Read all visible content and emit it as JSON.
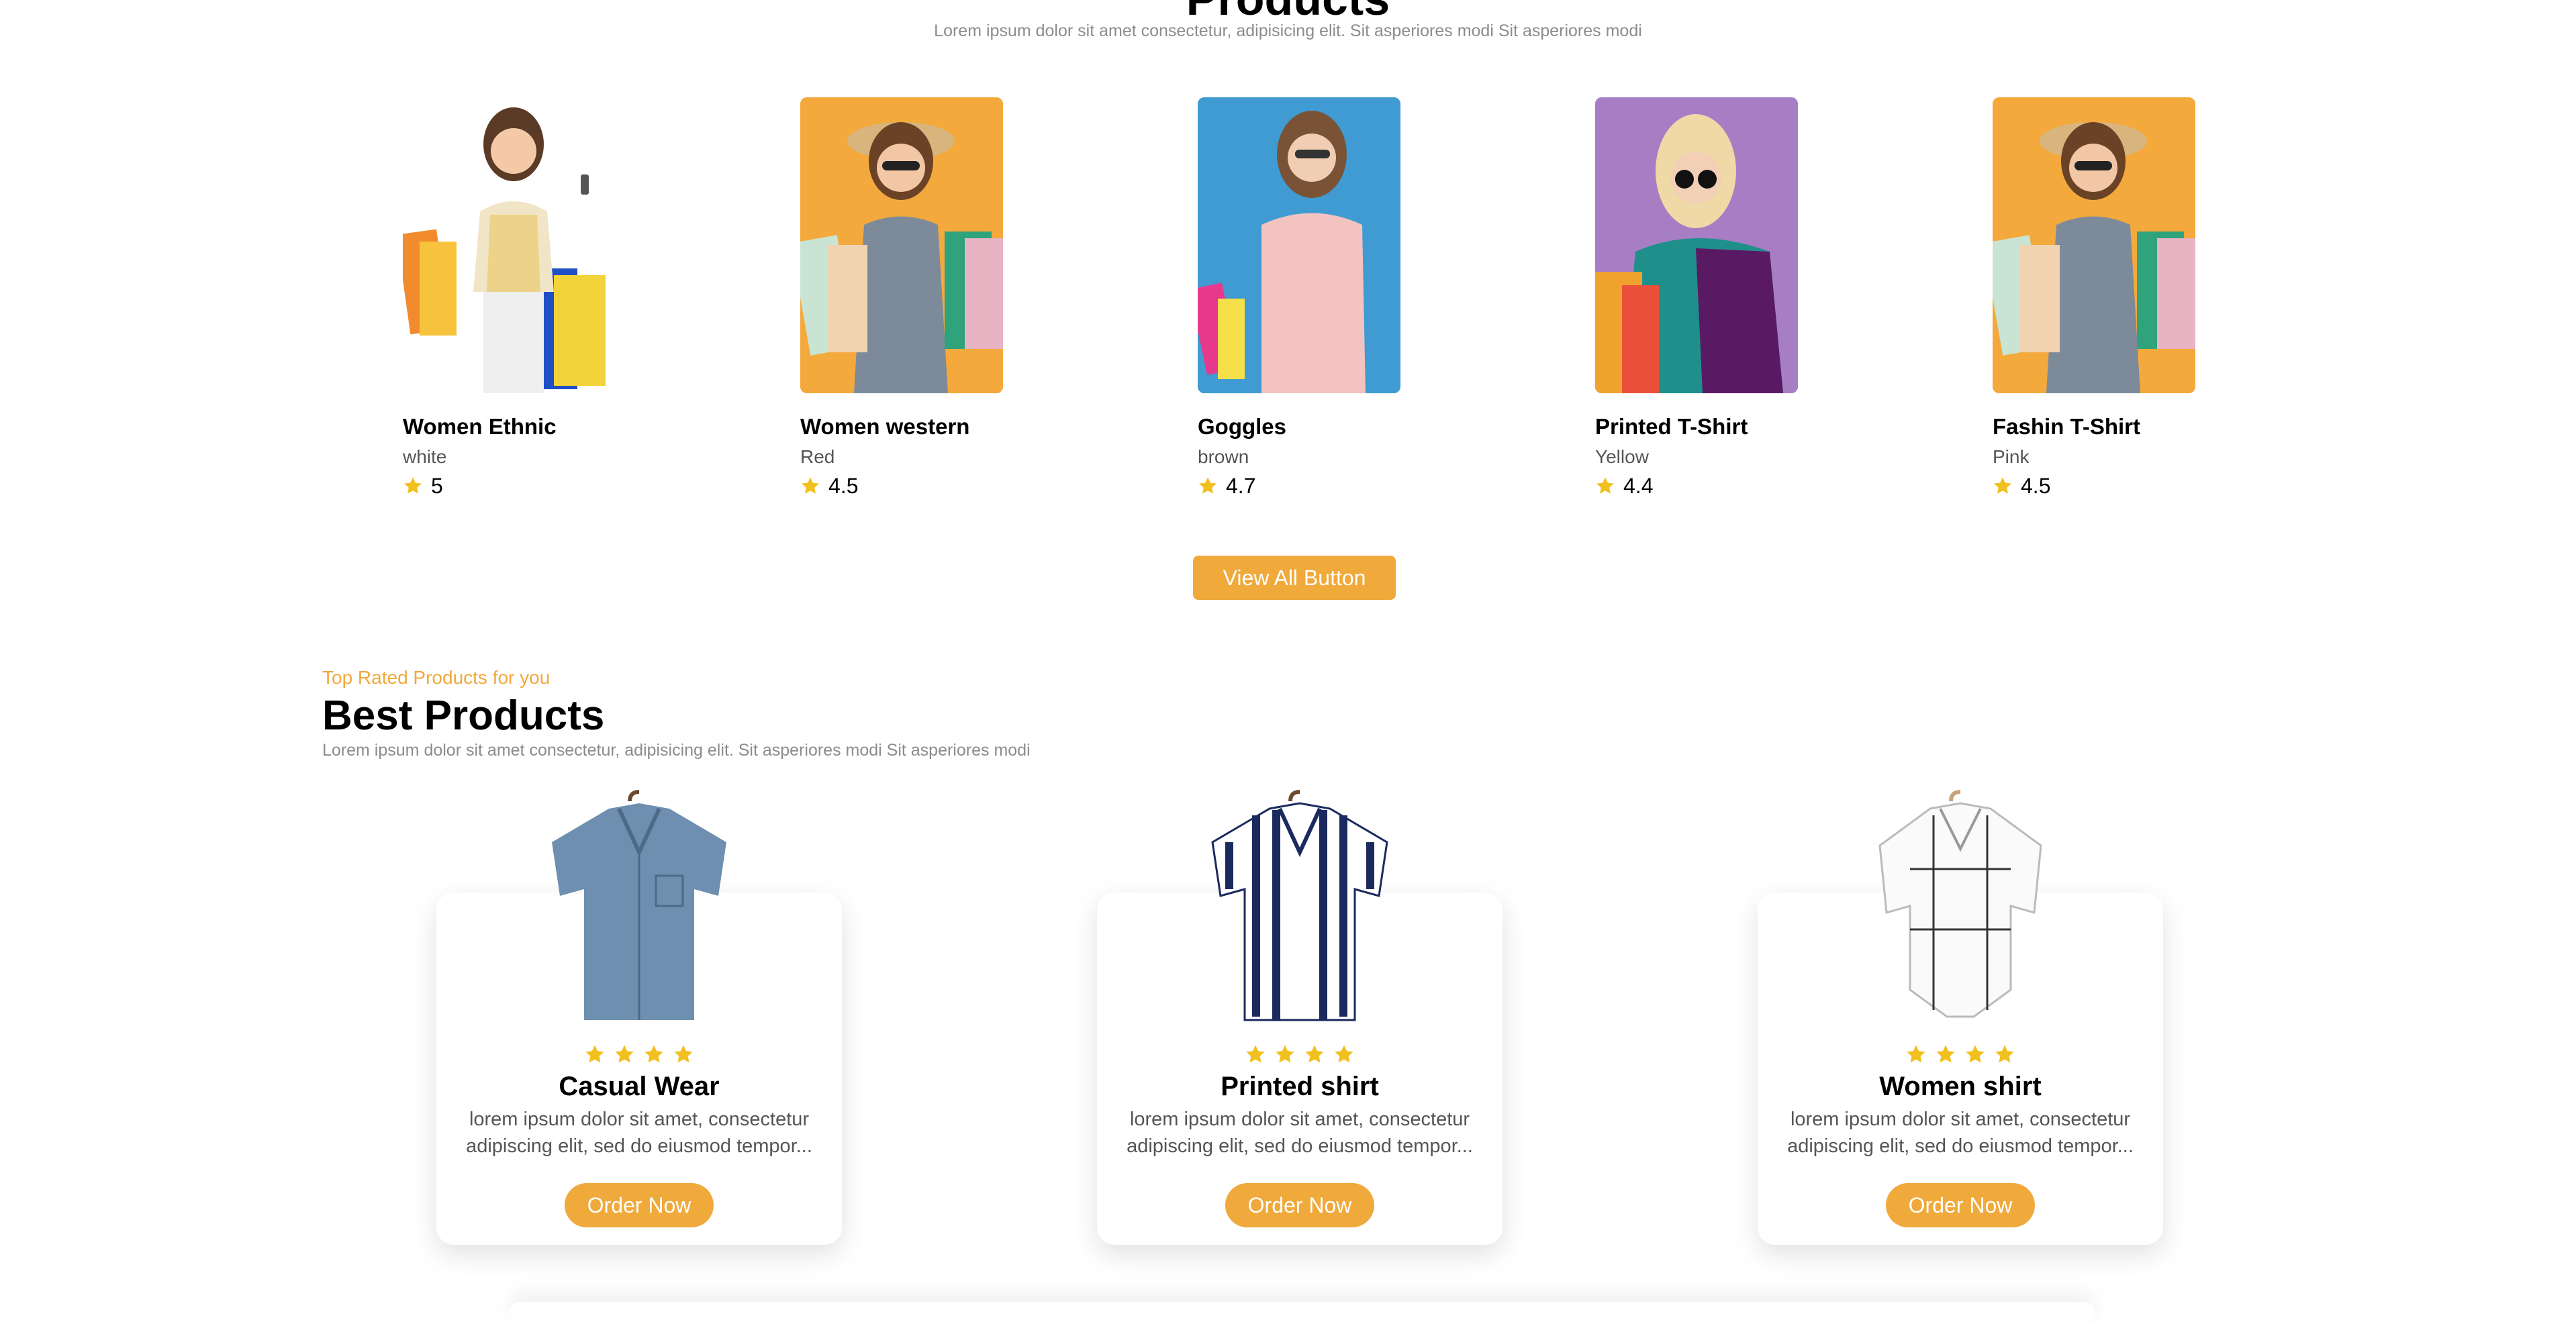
{
  "products_section": {
    "title": "Products",
    "subtitle": "Lorem ipsum dolor sit amet consectetur, adipisicing elit. Sit asperiores modi Sit asperiores modi",
    "items": [
      {
        "name": "Women Ethnic",
        "color": "white",
        "rating": "5",
        "bg": "#ffffff"
      },
      {
        "name": "Women western",
        "color": "Red",
        "rating": "4.5",
        "bg": "#f4a93c"
      },
      {
        "name": "Goggles",
        "color": "brown",
        "rating": "4.7",
        "bg": "#3f9bd2"
      },
      {
        "name": "Printed T-Shirt",
        "color": "Yellow",
        "rating": "4.4",
        "bg": "#a77ec4"
      },
      {
        "name": "Fashin T-Shirt",
        "color": "Pink",
        "rating": "4.5",
        "bg": "#f4a93c"
      }
    ],
    "view_all_label": "View All Button"
  },
  "best_section": {
    "kicker": "Top Rated Products for you",
    "title": "Best Products",
    "subtitle": "Lorem ipsum dolor sit amet consectetur, adipisicing elit. Sit asperiores modi Sit asperiores modi",
    "items": [
      {
        "name": "Casual Wear",
        "description": "lorem ipsum dolor sit amet, consectetur adipiscing elit, sed do eiusmod tempor...",
        "button": "Order Now",
        "stars": 4
      },
      {
        "name": "Printed shirt",
        "description": "lorem ipsum dolor sit amet, consectetur adipiscing elit, sed do eiusmod tempor...",
        "button": "Order Now",
        "stars": 4
      },
      {
        "name": "Women shirt",
        "description": "lorem ipsum dolor sit amet, consectetur adipiscing elit, sed do eiusmod tempor...",
        "button": "Order Now",
        "stars": 4
      }
    ]
  },
  "colors": {
    "accent": "#f0a93b",
    "star": "#f2c01e"
  }
}
